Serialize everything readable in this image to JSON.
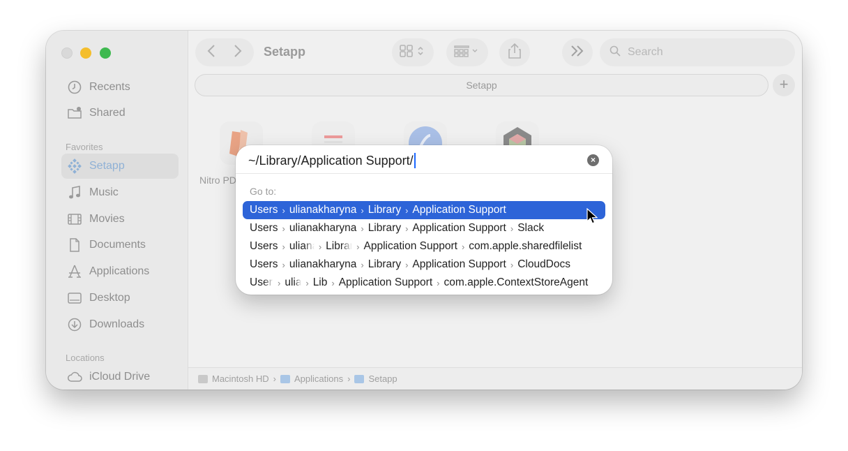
{
  "window": {
    "title": "Setapp",
    "path_bar": "Setapp",
    "plus_label": "+",
    "search_placeholder": "Search"
  },
  "sidebar": {
    "items": [
      {
        "label": "Recents",
        "icon": "clock-icon"
      },
      {
        "label": "Shared",
        "icon": "shared-folder-icon"
      }
    ],
    "favorites_label": "Favorites",
    "favorites": [
      {
        "label": "Setapp",
        "icon": "setapp-icon",
        "active": true
      },
      {
        "label": "Music",
        "icon": "music-note-icon"
      },
      {
        "label": "Movies",
        "icon": "film-icon"
      },
      {
        "label": "Documents",
        "icon": "document-icon"
      },
      {
        "label": "Applications",
        "icon": "applications-icon"
      },
      {
        "label": "Desktop",
        "icon": "desktop-icon"
      },
      {
        "label": "Downloads",
        "icon": "download-icon"
      }
    ],
    "locations_label": "Locations",
    "locations": [
      {
        "label": "iCloud Drive",
        "icon": "cloud-icon"
      }
    ]
  },
  "content": {
    "apps": [
      {
        "label": "Nitro PD",
        "icon": "nitro-pdf-app-icon"
      }
    ]
  },
  "status_bar": {
    "crumbs": [
      "Macintosh HD",
      "Applications",
      "Setapp"
    ]
  },
  "goto_dialog": {
    "input_value": "~/Library/Application Support/",
    "goto_label": "Go to:",
    "suggestions": [
      [
        "Users",
        "ulianakharyna",
        "Library",
        "Application Support"
      ],
      [
        "Users",
        "ulianakharyna",
        "Library",
        "Application Support",
        "Slack"
      ],
      [
        "Users",
        "uliana",
        "Librar",
        "Application Support",
        "com.apple.sharedfilelist"
      ],
      [
        "Users",
        "ulianakharyna",
        "Library",
        "Application Support",
        "CloudDocs"
      ],
      [
        "User",
        "ulia",
        "Lib",
        "Application Support",
        "com.apple.ContextStoreAgent"
      ]
    ]
  },
  "colors": {
    "selection": "#2d64d8",
    "traffic_min": "#f4be2c",
    "traffic_max": "#3fb950"
  }
}
